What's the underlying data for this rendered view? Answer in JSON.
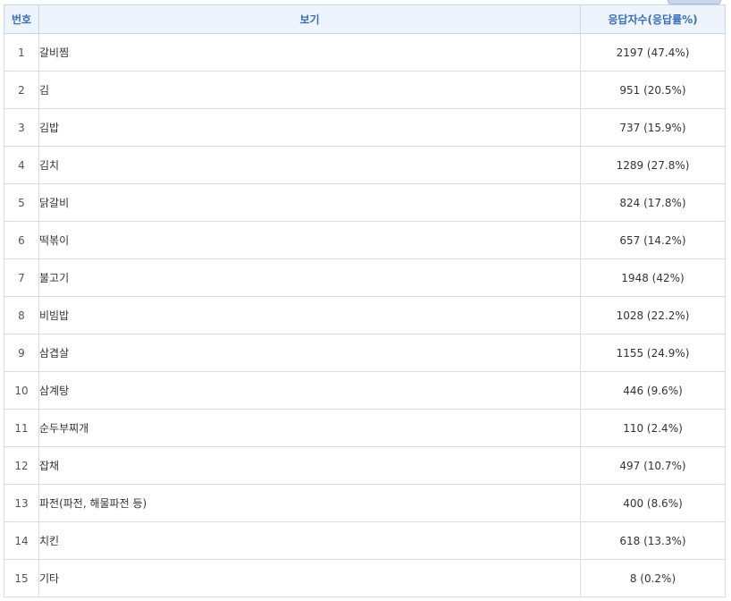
{
  "table": {
    "headers": {
      "number": "번호",
      "option": "보기",
      "responses": "응답자수(응답률%)"
    },
    "rows": [
      {
        "number": "1",
        "option": "갈비찜",
        "responses": "2197 (47.4%)"
      },
      {
        "number": "2",
        "option": "김",
        "responses": "951 (20.5%)"
      },
      {
        "number": "3",
        "option": "김밥",
        "responses": "737 (15.9%)"
      },
      {
        "number": "4",
        "option": "김치",
        "responses": "1289 (27.8%)"
      },
      {
        "number": "5",
        "option": "닭갈비",
        "responses": "824 (17.8%)"
      },
      {
        "number": "6",
        "option": "떡볶이",
        "responses": "657 (14.2%)"
      },
      {
        "number": "7",
        "option": "불고기",
        "responses": "1948 (42%)"
      },
      {
        "number": "8",
        "option": "비빔밥",
        "responses": "1028 (22.2%)"
      },
      {
        "number": "9",
        "option": "삼겹살",
        "responses": "1155 (24.9%)"
      },
      {
        "number": "10",
        "option": "삼계탕",
        "responses": "446 (9.6%)"
      },
      {
        "number": "11",
        "option": "순두부찌개",
        "responses": "110 (2.4%)"
      },
      {
        "number": "12",
        "option": "잡채",
        "responses": "497 (10.7%)"
      },
      {
        "number": "13",
        "option": "파전(파전, 해물파전 등)",
        "responses": "400 (8.6%)"
      },
      {
        "number": "14",
        "option": "치킨",
        "responses": "618 (13.3%)"
      },
      {
        "number": "15",
        "option": "기타",
        "responses": "8 (0.2%)"
      }
    ]
  }
}
